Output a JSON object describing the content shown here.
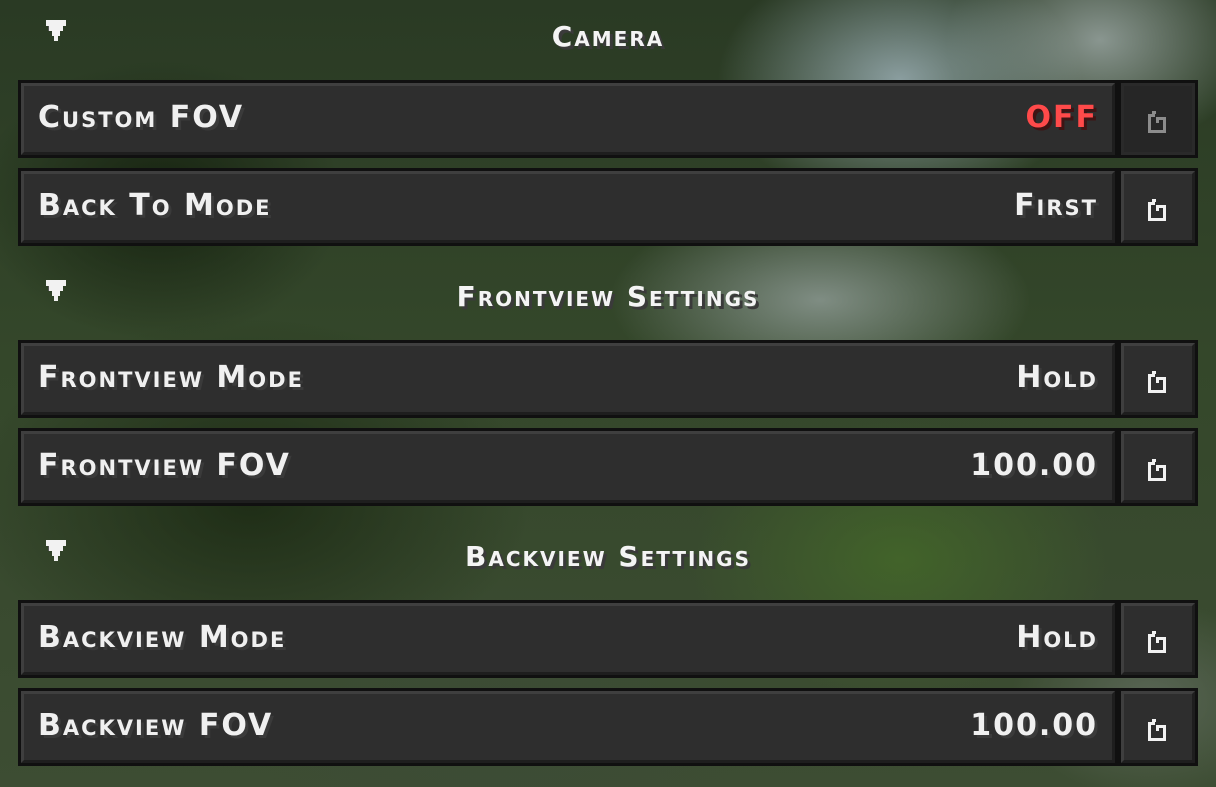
{
  "sections": [
    {
      "title": "Camera",
      "collapse_icon": "triangle-down-icon",
      "options": [
        {
          "label": "Custom FOV",
          "value": "OFF",
          "value_color": "#ff4a4a",
          "reset_enabled": false
        },
        {
          "label": "Back To Mode",
          "value": "First",
          "reset_enabled": true
        }
      ]
    },
    {
      "title": "Frontview Settings",
      "collapse_icon": "triangle-down-icon",
      "options": [
        {
          "label": "Frontview Mode",
          "value": "Hold",
          "reset_enabled": true
        },
        {
          "label": "Frontview FOV",
          "value": "100.00",
          "reset_enabled": true
        }
      ]
    },
    {
      "title": "Backview Settings",
      "collapse_icon": "triangle-down-icon",
      "options": [
        {
          "label": "Backview Mode",
          "value": "Hold",
          "reset_enabled": true
        },
        {
          "label": "Backview FOV",
          "value": "100.00",
          "reset_enabled": true
        }
      ]
    }
  ],
  "reset_icon": "reset-icon",
  "colors": {
    "text": "#f0f0f0",
    "off_value": "#ff4a4a",
    "button_fill": "#2e2e2e",
    "button_outline": "#101010"
  }
}
